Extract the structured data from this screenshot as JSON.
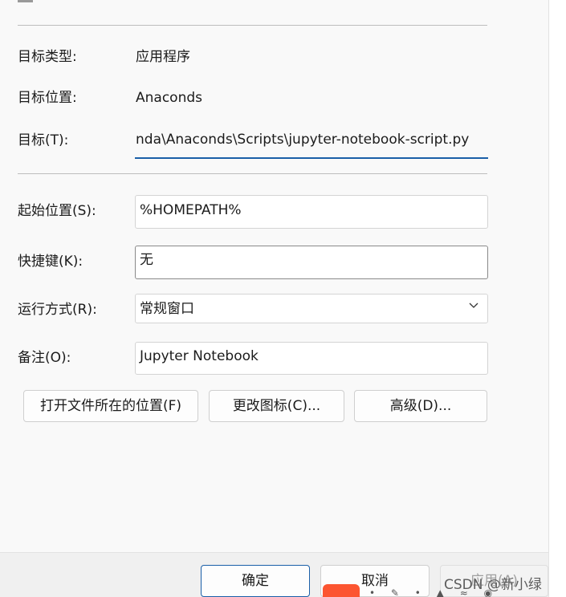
{
  "general": {
    "target_type_label": "目标类型:",
    "target_type_value": "应用程序",
    "target_location_label": "目标位置:",
    "target_location_value": "Anaconds",
    "target_label": "目标(T):",
    "target_value": "nda\\Anaconds\\Scripts\\jupyter-notebook-script.py"
  },
  "fields": {
    "start_in_label": "起始位置(S):",
    "start_in_value": "%HOMEPATH%",
    "shortcut_key_label": "快捷键(K):",
    "shortcut_key_value": "无",
    "run_label": "运行方式(R):",
    "run_value": "常规窗口",
    "comment_label": "备注(O):",
    "comment_value": "Jupyter Notebook"
  },
  "buttons": {
    "open_location": "打开文件所在的位置(F)",
    "change_icon": "更改图标(C)...",
    "advanced": "高级(D)..."
  },
  "footer": {
    "ok": "确定",
    "cancel": "取消",
    "apply": "应用(A)"
  },
  "watermark": "CSDN @新小绿",
  "colors": {
    "accent": "#1a5fa8",
    "csdn": "#fc5531"
  }
}
